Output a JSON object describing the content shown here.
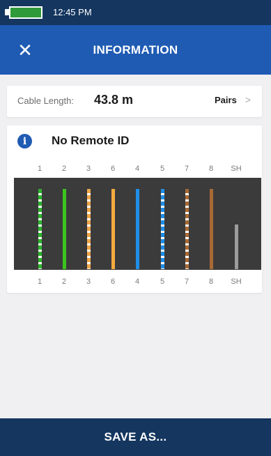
{
  "status": {
    "time": "12:45 PM",
    "battery_color": "#2f9a3a"
  },
  "header": {
    "title": "INFORMATION",
    "close_icon": "close-icon"
  },
  "cable": {
    "label": "Cable Length:",
    "value": "43.8 m",
    "pairs_label": "Pairs",
    "pairs_chevron": ">"
  },
  "remote": {
    "info_icon": "i",
    "label": "No Remote ID"
  },
  "wires": [
    {
      "pin": "1",
      "color": "#2db52d",
      "striped": true,
      "length": 1.0
    },
    {
      "pin": "2",
      "color": "#3cc41e",
      "striped": false,
      "length": 1.0
    },
    {
      "pin": "3",
      "color": "#f0a64a",
      "striped": true,
      "length": 1.0
    },
    {
      "pin": "6",
      "color": "#f5ab3f",
      "striped": false,
      "length": 1.0
    },
    {
      "pin": "4",
      "color": "#1f8ee8",
      "striped": false,
      "length": 1.0
    },
    {
      "pin": "5",
      "color": "#1f8ee8",
      "striped": true,
      "length": 1.0
    },
    {
      "pin": "7",
      "color": "#a86a35",
      "striped": true,
      "length": 1.0
    },
    {
      "pin": "8",
      "color": "#a86a35",
      "striped": false,
      "length": 1.0
    },
    {
      "pin": "SH",
      "color": "#9c9c9c",
      "striped": false,
      "length": 0.56
    }
  ],
  "actions": {
    "save_label": "SAVE AS..."
  }
}
